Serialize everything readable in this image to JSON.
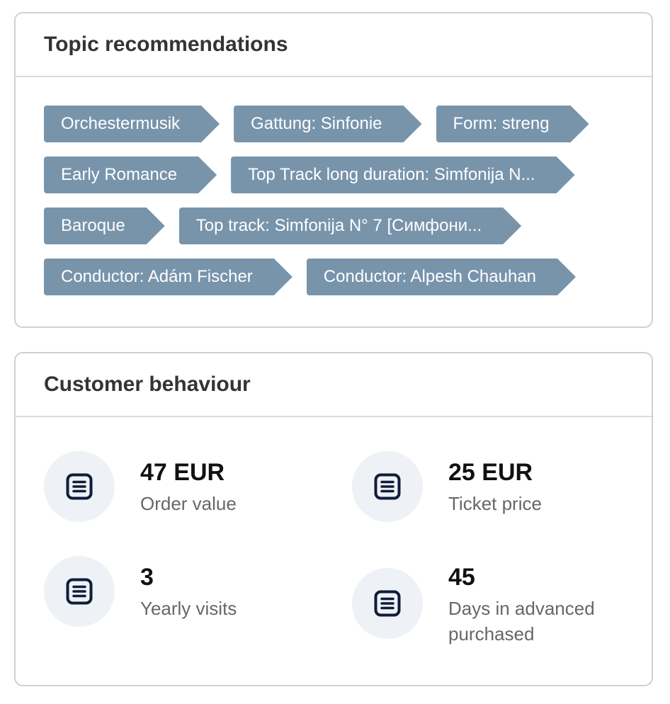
{
  "topics": {
    "title": "Topic recommendations",
    "rows": [
      [
        "Orchestermusik",
        "Gattung: Sinfonie",
        "Form: streng"
      ],
      [
        "Early Romance",
        "Top Track long duration: Simfonija N..."
      ],
      [
        "Baroque",
        "Top track: Simfonija N° 7 [Симфони..."
      ],
      [
        "Conductor: Adám Fischer",
        "Conductor: Alpesh Chauhan"
      ]
    ]
  },
  "behaviour": {
    "title": "Customer behaviour",
    "stats": [
      {
        "value": "47 EUR",
        "label": "Order value",
        "icon": "document-lines-icon"
      },
      {
        "value": "25 EUR",
        "label": "Ticket price",
        "icon": "document-lines-icon"
      },
      {
        "value": "3",
        "label": "Yearly visits",
        "icon": "document-lines-icon"
      },
      {
        "value": "45",
        "label": "Days in advanced purchased",
        "icon": "document-lines-icon"
      }
    ]
  },
  "colors": {
    "tag_background": "#7894ab",
    "icon_stroke": "#0f1d3a",
    "icon_circle": "#eef1f5"
  }
}
